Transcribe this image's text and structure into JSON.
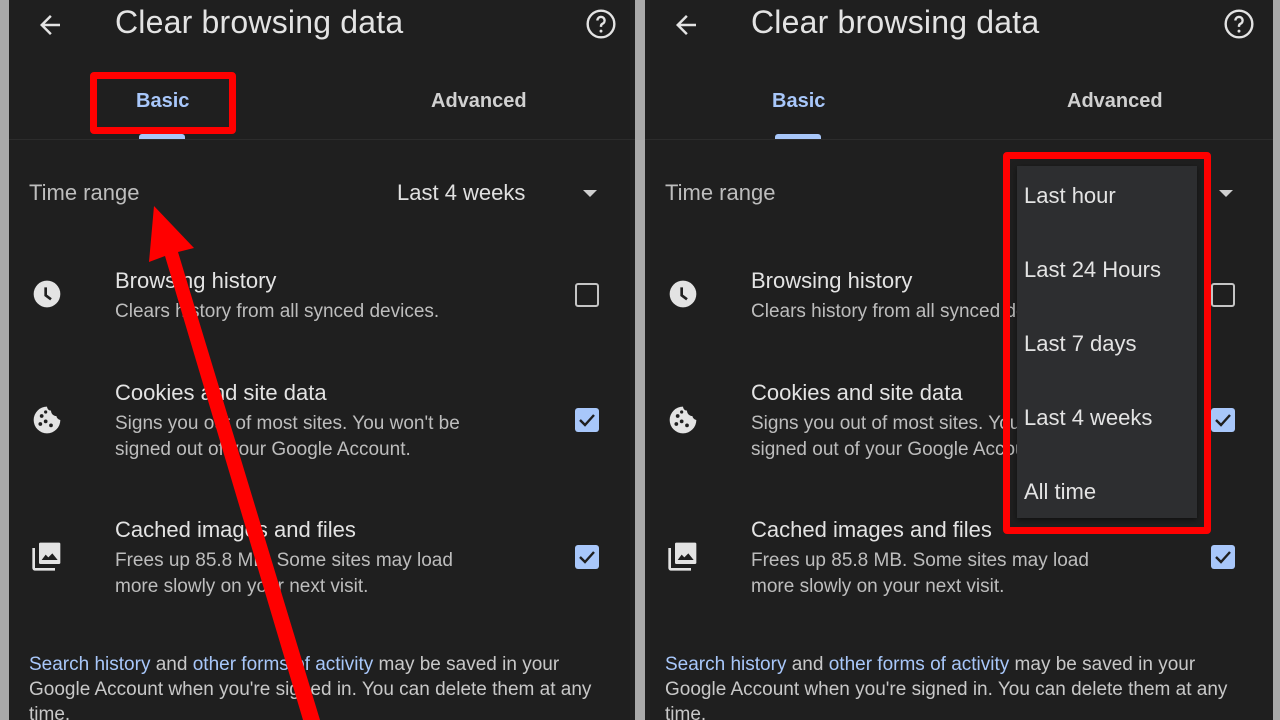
{
  "panels": [
    {
      "header": {
        "title": "Clear browsing data",
        "back_icon": "arrow-left-icon",
        "help_icon": "help-circle-icon"
      },
      "tabs": [
        {
          "label": "Basic",
          "selected": true
        },
        {
          "label": "Advanced",
          "selected": false
        }
      ],
      "time_range": {
        "label": "Time range",
        "value": "Last 4 weeks"
      },
      "items": [
        {
          "title": "Browsing history",
          "desc": [
            "Clears history from all synced devices."
          ],
          "icon": "clock-icon",
          "checked": false
        },
        {
          "title": "Cookies and site data",
          "desc": [
            "Signs you out of most sites. You won't be",
            "signed out of your Google Account."
          ],
          "icon": "cookie-icon",
          "checked": true
        },
        {
          "title": "Cached images and files",
          "desc": [
            "Frees up 85.8 MB. Some sites may load",
            "more slowly on your next visit."
          ],
          "icon": "image-stack-icon",
          "checked": true
        }
      ],
      "footer": {
        "link1": "Search history",
        "text1": " and ",
        "link2": "other forms of activity",
        "text2": " may be saved in your Google Account when you're signed in. You can delete them at any time."
      },
      "annotations": {
        "highlight": "Basic tab",
        "arrow_target": "Time range"
      }
    },
    {
      "header": {
        "title": "Clear browsing data",
        "back_icon": "arrow-left-icon",
        "help_icon": "help-circle-icon"
      },
      "tabs": [
        {
          "label": "Basic",
          "selected": true
        },
        {
          "label": "Advanced",
          "selected": false
        }
      ],
      "time_range": {
        "label": "Time range",
        "value": "Last 4 weeks"
      },
      "items": [
        {
          "title": "Browsing history",
          "desc": [
            "Clears history from all synced devices."
          ],
          "icon": "clock-icon",
          "checked": false
        },
        {
          "title": "Cookies and site data",
          "desc": [
            "Signs you out of most sites. You won't be",
            "signed out of your Google Account."
          ],
          "icon": "cookie-icon",
          "checked": true
        },
        {
          "title": "Cached images and files",
          "desc": [
            "Frees up 85.8 MB. Some sites may load",
            "more slowly on your next visit."
          ],
          "icon": "image-stack-icon",
          "checked": true
        }
      ],
      "dropdown": {
        "options": [
          "Last hour",
          "Last 24 Hours",
          "Last 7 days",
          "Last 4 weeks",
          "All time"
        ]
      },
      "footer": {
        "link1": "Search history",
        "text1": " and ",
        "link2": "other forms of activity",
        "text2": " may be saved in your Google Account when you're signed in. You can delete them at any time."
      },
      "annotations": {
        "highlight": "Time range dropdown"
      }
    }
  ],
  "colors": {
    "background": "#1f1f1f",
    "accent": "#a8c7fa",
    "annotation": "#ff0000",
    "menu": "#2d2e30"
  }
}
